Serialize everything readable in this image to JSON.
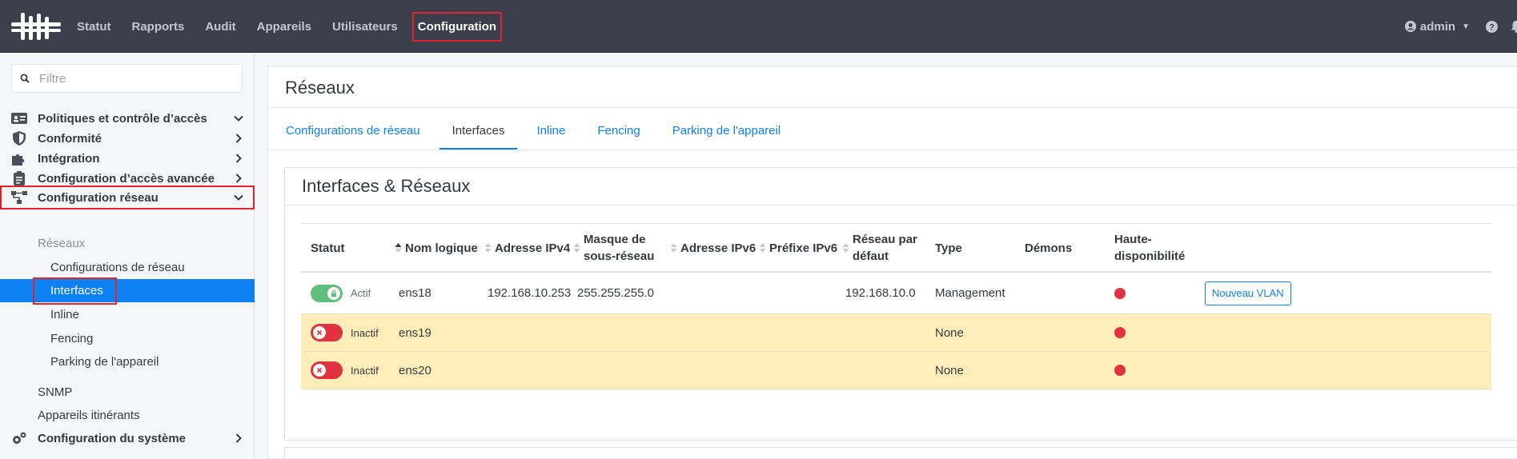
{
  "topbar": {
    "nav": [
      "Statut",
      "Rapports",
      "Audit",
      "Appareils",
      "Utilisateurs",
      "Configuration"
    ],
    "active_nav": "Configuration",
    "user": "admin"
  },
  "sidebar": {
    "filter_placeholder": "Filtre",
    "sections": {
      "policies": "Politiques et contrôle d’accès",
      "compliance": "Conformité",
      "integration": "Intégration",
      "advanced": "Configuration d’accès avancée",
      "network": "Configuration réseau",
      "system": "Configuration du système"
    },
    "network_children": {
      "group": "Réseaux",
      "items": [
        "Configurations de réseau",
        "Interfaces",
        "Inline",
        "Fencing",
        "Parking de l'appareil"
      ],
      "snmp": "SNMP",
      "roaming": "Appareils itinérants"
    }
  },
  "main": {
    "title": "Réseaux",
    "tabs": [
      "Configurations de réseau",
      "Interfaces",
      "Inline",
      "Fencing",
      "Parking de l'appareil"
    ],
    "active_tab": "Interfaces",
    "card_title": "Interfaces & Réseaux"
  },
  "table": {
    "headers": {
      "status": "Statut",
      "name": "Nom logique",
      "ipv4": "Adresse IPv4",
      "mask_1": "Masque de",
      "mask_2": "sous-réseau",
      "ipv6": "Adresse IPv6",
      "prefix": "Préfixe IPv6",
      "defnet_1": "Réseau par",
      "defnet_2": "défaut",
      "type": "Type",
      "daemons": "Démons",
      "ha_1": "Haute-",
      "ha_2": "disponibilité"
    },
    "rows": [
      {
        "active": true,
        "state": "Actif",
        "name": "ens18",
        "ipv4": "192.168.10.253",
        "mask": "255.255.255.0",
        "ipv6": "",
        "prefix": "",
        "network": "192.168.10.0",
        "type": "Management",
        "daemons": "",
        "action": "Nouveau VLAN"
      },
      {
        "active": false,
        "state": "Inactif",
        "name": "ens19",
        "ipv4": "",
        "mask": "",
        "ipv6": "",
        "prefix": "",
        "network": "",
        "type": "None",
        "daemons": "",
        "action": ""
      },
      {
        "active": false,
        "state": "Inactif",
        "name": "ens20",
        "ipv4": "",
        "mask": "",
        "ipv6": "",
        "prefix": "",
        "network": "",
        "type": "None",
        "daemons": "",
        "action": ""
      }
    ]
  },
  "colors": {
    "topbar": "#3a3f4b",
    "accent": "#0d80f2",
    "highlight": "#e0242c",
    "inactive_row": "#ffeeba",
    "toggle_on": "#5fbf7b",
    "toggle_off": "#e0333f"
  }
}
